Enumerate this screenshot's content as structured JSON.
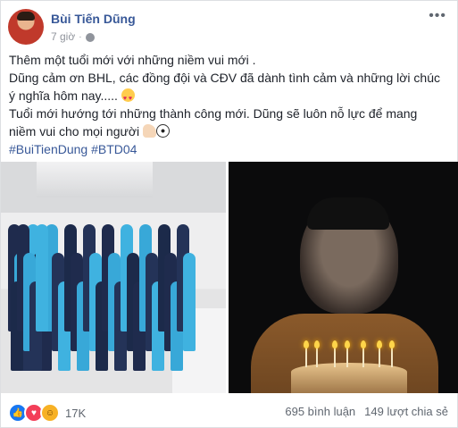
{
  "post": {
    "author": "Bùi Tiến Dũng",
    "time": "7 giờ",
    "privacy_icon": "globe-icon",
    "lines": [
      "Thêm một tuổi mới với những niềm vui mới .",
      "Dũng cảm ơn BHL, các đồng đội và CĐV đã dành tình cảm và những lời chúc",
      "ý nghĩa hôm nay.....",
      "Tuổi mới hướng tới những thành công mới. Dũng sẽ luôn nỗ lực để mang",
      "niềm vui cho mọi người"
    ],
    "hashtags": [
      "#BuiTienDung",
      "#BTD04"
    ]
  },
  "footer": {
    "reaction_count": "17K",
    "comments": "695 bình luận",
    "shares": "149 lượt chia sẻ"
  },
  "colors": {
    "link": "#385898",
    "like": "#1877f2",
    "love": "#f33e58",
    "haha": "#f7b125"
  }
}
